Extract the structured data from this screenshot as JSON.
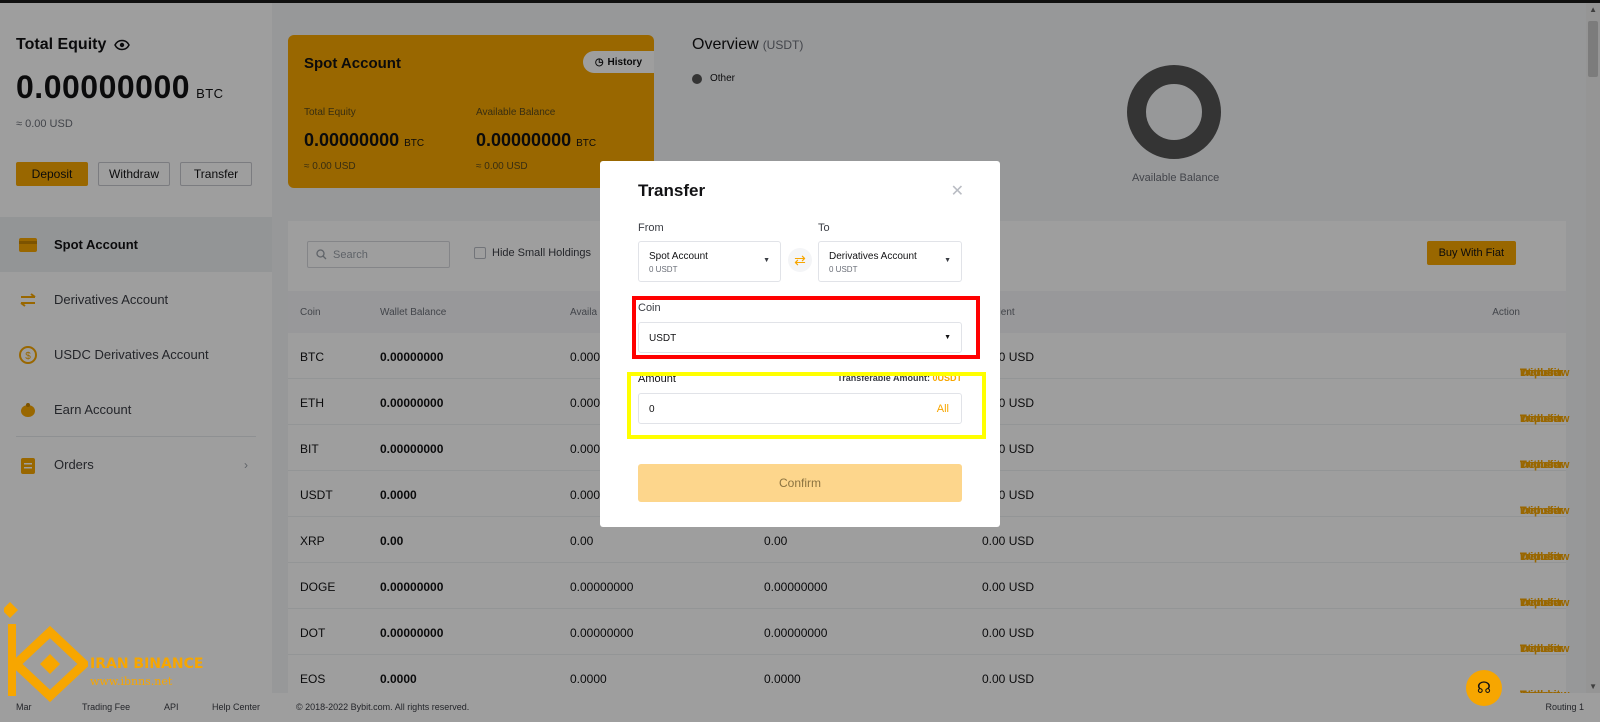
{
  "left": {
    "equity_title": "Total Equity",
    "equity_value": "0.00000000",
    "equity_unit": "BTC",
    "equity_usd": "≈ 0.00 USD",
    "buttons": {
      "deposit": "Deposit",
      "withdraw": "Withdraw",
      "transfer": "Transfer"
    },
    "nav": [
      {
        "label": "Spot Account",
        "icon": "card-icon"
      },
      {
        "label": "Derivatives Account",
        "icon": "swap-icon"
      },
      {
        "label": "USDC Derivatives Account",
        "icon": "dollar-coin-icon"
      },
      {
        "label": "Earn Account",
        "icon": "piggy-bank-icon"
      },
      {
        "label": "Orders",
        "icon": "clipboard-icon"
      }
    ]
  },
  "spot_card": {
    "title": "Spot Account",
    "history": "History",
    "total_equity_label": "Total Equity",
    "total_equity_value": "0.00000000",
    "available_label": "Available Balance",
    "available_value": "0.00000000",
    "unit": "BTC",
    "usd": "≈ 0.00 USD"
  },
  "overview": {
    "title": "Overview",
    "unit": "(USDT)",
    "legend": "Other",
    "donut_label": "Available Balance"
  },
  "table": {
    "search_placeholder": "Search",
    "hide_small": "Hide Small Holdings",
    "buy_fiat": "Buy With Fiat",
    "headers": {
      "coin": "Coin",
      "wallet": "Wallet Balance",
      "avail": "Availa",
      "equiv": "valent",
      "action": "Action"
    },
    "rows": [
      {
        "coin": "BTC",
        "wallet": "0.00000000",
        "avail": "0.000",
        "c3": "",
        "equiv": "0.00 USD",
        "actions": [
          "Deposit",
          "Withdraw",
          "Transfer",
          "Trade"
        ]
      },
      {
        "coin": "ETH",
        "wallet": "0.00000000",
        "avail": "0.000",
        "c3": "",
        "equiv": "0.00 USD",
        "actions": [
          "Deposit",
          "Withdraw",
          "Transfer",
          "Trade"
        ]
      },
      {
        "coin": "BIT",
        "wallet": "0.00000000",
        "avail": "0.000",
        "c3": "",
        "equiv": "0.00 USD",
        "actions": [
          "Deposit",
          "Withdraw",
          "Transfer",
          "Trade"
        ]
      },
      {
        "coin": "USDT",
        "wallet": "0.0000",
        "avail": "0.000",
        "c3": "",
        "equiv": "0.00 USD",
        "actions": [
          "Deposit",
          "Withdraw",
          "Transfer"
        ]
      },
      {
        "coin": "XRP",
        "wallet": "0.00",
        "avail": "0.00",
        "c3": "0.00",
        "equiv": "0.00 USD",
        "actions": [
          "Deposit",
          "Withdraw",
          "Transfer",
          "Trade"
        ]
      },
      {
        "coin": "DOGE",
        "wallet": "0.00000000",
        "avail": "0.00000000",
        "c3": "0.00000000",
        "equiv": "0.00 USD",
        "actions": [
          "Deposit",
          "Withdraw",
          "Transfer",
          "Trade"
        ]
      },
      {
        "coin": "DOT",
        "wallet": "0.00000000",
        "avail": "0.00000000",
        "c3": "0.00000000",
        "equiv": "0.00 USD",
        "actions": [
          "Deposit",
          "Withdraw",
          "Transfer",
          "Trade"
        ]
      },
      {
        "coin": "EOS",
        "wallet": "0.0000",
        "avail": "0.0000",
        "c3": "0.0000",
        "equiv": "0.00 USD",
        "actions": [
          "Deposit",
          "Withdraw",
          "",
          "Trade"
        ]
      }
    ]
  },
  "footer": {
    "items": [
      "Mar",
      "Trading Fee",
      "API",
      "Help Center"
    ],
    "copyright": "© 2018-2022 Bybit.com. All rights reserved.",
    "routing": "Routing 1"
  },
  "modal": {
    "title": "Transfer",
    "from_label": "From",
    "to_label": "To",
    "from_account": "Spot Account",
    "from_balance": "0 USDT",
    "to_account": "Derivatives Account",
    "to_balance": "0 USDT",
    "coin_label": "Coin",
    "coin_value": "USDT",
    "amount_label": "Amount",
    "transferable_label": "Transferable Amount:",
    "transferable_value": "0USDT",
    "amount_value": "0",
    "all": "All",
    "confirm": "Confirm"
  },
  "watermark": {
    "name": "IRAN BINANCE",
    "url": "www.ibnns.net"
  },
  "colors": {
    "accent": "#f7a600",
    "highlight_red": "#ff0000",
    "highlight_yellow": "#ffff00"
  }
}
